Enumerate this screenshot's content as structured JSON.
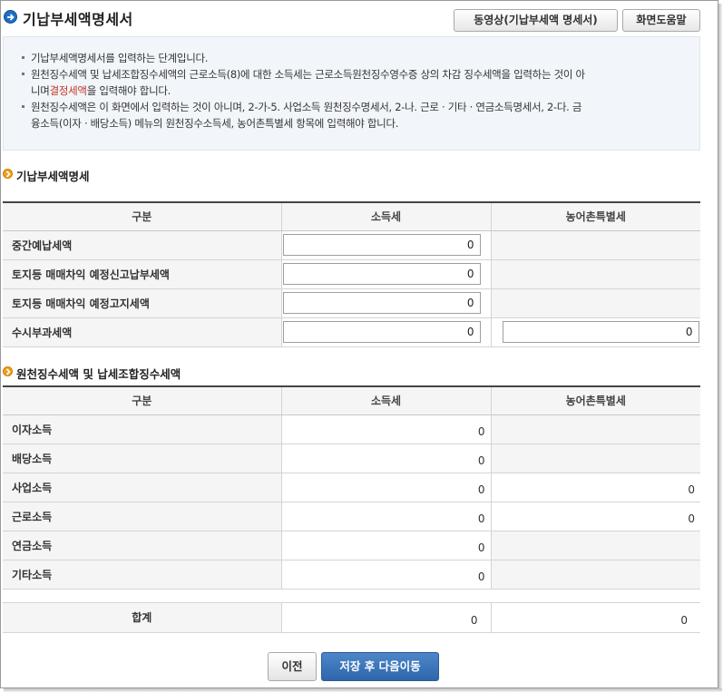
{
  "header": {
    "title": "기납부세액명세서",
    "video_button": "동영상(기납부세액 명세서)",
    "help_button": "화면도움말"
  },
  "info": {
    "line1": "기납부세액명세서를 입력하는 단계입니다.",
    "line2a": "원천징수세액 및 납세조합징수세액의 근로소득(8)에 대한 소득세는 근로소득원천징수영수증 상의 차감 징수세액을 입력하는 것이 아",
    "line2b_pre": "니며",
    "line2b_red": "결정세액",
    "line2b_post": "을 입력해야 합니다.",
    "line3a": "원천징수세액은 이 화면에서 입력하는 것이 아니며, 2-가-5. 사업소득 원천징수명세서, 2-나. 근로 · 기타 · 연금소득명세서, 2-다. 금",
    "line3b": "융소득(이자 · 배당소득) 메뉴의 원천징수소득세, 농어촌특별세 항목에 입력해야 합니다."
  },
  "section1": {
    "title": "기납부세액명세",
    "headers": [
      "구분",
      "소득세",
      "농어촌특별세"
    ],
    "rows": [
      {
        "label": "중간예납세액",
        "income_tax": "0",
        "rural_tax": ""
      },
      {
        "label": "토지등 매매차익 예정신고납부세액",
        "income_tax": "0",
        "rural_tax": ""
      },
      {
        "label": "토지등 매매차익 예정고지세액",
        "income_tax": "0",
        "rural_tax": ""
      },
      {
        "label": "수시부과세액",
        "income_tax": "0",
        "rural_tax": "0"
      }
    ]
  },
  "section2": {
    "title": "원천징수세액 및 납세조합징수세액",
    "headers": [
      "구분",
      "소득세",
      "농어촌특별세"
    ],
    "rows": [
      {
        "label": "이자소득",
        "income_tax": "0",
        "rural_tax": ""
      },
      {
        "label": "배당소득",
        "income_tax": "0",
        "rural_tax": ""
      },
      {
        "label": "사업소득",
        "income_tax": "0",
        "rural_tax": "0"
      },
      {
        "label": "근로소득",
        "income_tax": "0",
        "rural_tax": "0"
      },
      {
        "label": "연금소득",
        "income_tax": "0",
        "rural_tax": ""
      },
      {
        "label": "기타소득",
        "income_tax": "0",
        "rural_tax": ""
      }
    ],
    "total": {
      "label": "합계",
      "income_tax": "0",
      "rural_tax": "0"
    }
  },
  "footer": {
    "prev_button": "이전",
    "next_button": "저장 후 다음이동"
  },
  "colors": {
    "title_icon": "#1f6fc4",
    "section_icon": "#f0a020",
    "next_button": "#3a74b8",
    "highlight_text": "#c0392b"
  }
}
